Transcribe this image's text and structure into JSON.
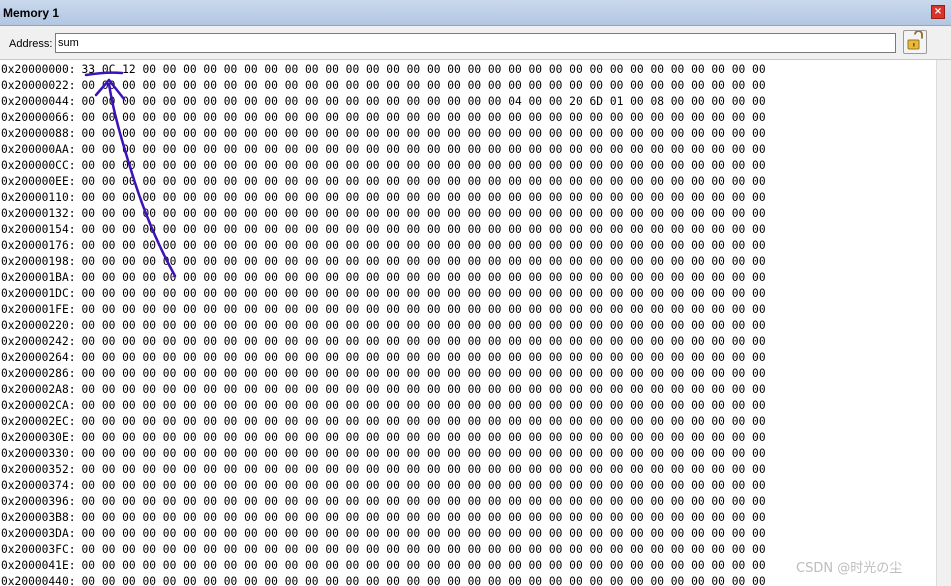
{
  "window": {
    "title": "Memory 1",
    "close_glyph": "×"
  },
  "toolbar": {
    "address_label": "Address:",
    "address_value": "sum",
    "lock_icon": "unlock-icon"
  },
  "memory": {
    "rows": [
      {
        "address": "0x20000000:",
        "bytes": "33 0C 12 00 00 00 00 00 00 00 00 00 00 00 00 00 00 00 00 00 00 00 00 00 00 00 00 00 00 00 00 00 00 00"
      },
      {
        "address": "0x20000022:",
        "bytes": "00 00 00 00 00 00 00 00 00 00 00 00 00 00 00 00 00 00 00 00 00 00 00 00 00 00 00 00 00 00 00 00 00 00"
      },
      {
        "address": "0x20000044:",
        "bytes": "00 00 00 00 00 00 00 00 00 00 00 00 00 00 00 00 00 00 00 00 00 04 00 00 20 6D 01 00 08 00 00 00 00 00"
      },
      {
        "address": "0x20000066:",
        "bytes": "00 00 00 00 00 00 00 00 00 00 00 00 00 00 00 00 00 00 00 00 00 00 00 00 00 00 00 00 00 00 00 00 00 00"
      },
      {
        "address": "0x20000088:",
        "bytes": "00 00 00 00 00 00 00 00 00 00 00 00 00 00 00 00 00 00 00 00 00 00 00 00 00 00 00 00 00 00 00 00 00 00"
      },
      {
        "address": "0x200000AA:",
        "bytes": "00 00 00 00 00 00 00 00 00 00 00 00 00 00 00 00 00 00 00 00 00 00 00 00 00 00 00 00 00 00 00 00 00 00"
      },
      {
        "address": "0x200000CC:",
        "bytes": "00 00 00 00 00 00 00 00 00 00 00 00 00 00 00 00 00 00 00 00 00 00 00 00 00 00 00 00 00 00 00 00 00 00"
      },
      {
        "address": "0x200000EE:",
        "bytes": "00 00 00 00 00 00 00 00 00 00 00 00 00 00 00 00 00 00 00 00 00 00 00 00 00 00 00 00 00 00 00 00 00 00"
      },
      {
        "address": "0x20000110:",
        "bytes": "00 00 00 00 00 00 00 00 00 00 00 00 00 00 00 00 00 00 00 00 00 00 00 00 00 00 00 00 00 00 00 00 00 00"
      },
      {
        "address": "0x20000132:",
        "bytes": "00 00 00 00 00 00 00 00 00 00 00 00 00 00 00 00 00 00 00 00 00 00 00 00 00 00 00 00 00 00 00 00 00 00"
      },
      {
        "address": "0x20000154:",
        "bytes": "00 00 00 00 00 00 00 00 00 00 00 00 00 00 00 00 00 00 00 00 00 00 00 00 00 00 00 00 00 00 00 00 00 00"
      },
      {
        "address": "0x20000176:",
        "bytes": "00 00 00 00 00 00 00 00 00 00 00 00 00 00 00 00 00 00 00 00 00 00 00 00 00 00 00 00 00 00 00 00 00 00"
      },
      {
        "address": "0x20000198:",
        "bytes": "00 00 00 00 00 00 00 00 00 00 00 00 00 00 00 00 00 00 00 00 00 00 00 00 00 00 00 00 00 00 00 00 00 00"
      },
      {
        "address": "0x200001BA:",
        "bytes": "00 00 00 00 00 00 00 00 00 00 00 00 00 00 00 00 00 00 00 00 00 00 00 00 00 00 00 00 00 00 00 00 00 00"
      },
      {
        "address": "0x200001DC:",
        "bytes": "00 00 00 00 00 00 00 00 00 00 00 00 00 00 00 00 00 00 00 00 00 00 00 00 00 00 00 00 00 00 00 00 00 00"
      },
      {
        "address": "0x200001FE:",
        "bytes": "00 00 00 00 00 00 00 00 00 00 00 00 00 00 00 00 00 00 00 00 00 00 00 00 00 00 00 00 00 00 00 00 00 00"
      },
      {
        "address": "0x20000220:",
        "bytes": "00 00 00 00 00 00 00 00 00 00 00 00 00 00 00 00 00 00 00 00 00 00 00 00 00 00 00 00 00 00 00 00 00 00"
      },
      {
        "address": "0x20000242:",
        "bytes": "00 00 00 00 00 00 00 00 00 00 00 00 00 00 00 00 00 00 00 00 00 00 00 00 00 00 00 00 00 00 00 00 00 00"
      },
      {
        "address": "0x20000264:",
        "bytes": "00 00 00 00 00 00 00 00 00 00 00 00 00 00 00 00 00 00 00 00 00 00 00 00 00 00 00 00 00 00 00 00 00 00"
      },
      {
        "address": "0x20000286:",
        "bytes": "00 00 00 00 00 00 00 00 00 00 00 00 00 00 00 00 00 00 00 00 00 00 00 00 00 00 00 00 00 00 00 00 00 00"
      },
      {
        "address": "0x200002A8:",
        "bytes": "00 00 00 00 00 00 00 00 00 00 00 00 00 00 00 00 00 00 00 00 00 00 00 00 00 00 00 00 00 00 00 00 00 00"
      },
      {
        "address": "0x200002CA:",
        "bytes": "00 00 00 00 00 00 00 00 00 00 00 00 00 00 00 00 00 00 00 00 00 00 00 00 00 00 00 00 00 00 00 00 00 00"
      },
      {
        "address": "0x200002EC:",
        "bytes": "00 00 00 00 00 00 00 00 00 00 00 00 00 00 00 00 00 00 00 00 00 00 00 00 00 00 00 00 00 00 00 00 00 00"
      },
      {
        "address": "0x2000030E:",
        "bytes": "00 00 00 00 00 00 00 00 00 00 00 00 00 00 00 00 00 00 00 00 00 00 00 00 00 00 00 00 00 00 00 00 00 00"
      },
      {
        "address": "0x20000330:",
        "bytes": "00 00 00 00 00 00 00 00 00 00 00 00 00 00 00 00 00 00 00 00 00 00 00 00 00 00 00 00 00 00 00 00 00 00"
      },
      {
        "address": "0x20000352:",
        "bytes": "00 00 00 00 00 00 00 00 00 00 00 00 00 00 00 00 00 00 00 00 00 00 00 00 00 00 00 00 00 00 00 00 00 00"
      },
      {
        "address": "0x20000374:",
        "bytes": "00 00 00 00 00 00 00 00 00 00 00 00 00 00 00 00 00 00 00 00 00 00 00 00 00 00 00 00 00 00 00 00 00 00"
      },
      {
        "address": "0x20000396:",
        "bytes": "00 00 00 00 00 00 00 00 00 00 00 00 00 00 00 00 00 00 00 00 00 00 00 00 00 00 00 00 00 00 00 00 00 00"
      },
      {
        "address": "0x200003B8:",
        "bytes": "00 00 00 00 00 00 00 00 00 00 00 00 00 00 00 00 00 00 00 00 00 00 00 00 00 00 00 00 00 00 00 00 00 00"
      },
      {
        "address": "0x200003DA:",
        "bytes": "00 00 00 00 00 00 00 00 00 00 00 00 00 00 00 00 00 00 00 00 00 00 00 00 00 00 00 00 00 00 00 00 00 00"
      },
      {
        "address": "0x200003FC:",
        "bytes": "00 00 00 00 00 00 00 00 00 00 00 00 00 00 00 00 00 00 00 00 00 00 00 00 00 00 00 00 00 00 00 00 00 00"
      },
      {
        "address": "0x2000041E:",
        "bytes": "00 00 00 00 00 00 00 00 00 00 00 00 00 00 00 00 00 00 00 00 00 00 00 00 00 00 00 00 00 00 00 00 00 00"
      },
      {
        "address": "0x20000440:",
        "bytes": "00 00 00 00 00 00 00 00 00 00 00 00 00 00 00 00 00 00 00 00 00 00 00 00 00 00 00 00 00 00 00 00 00 00"
      }
    ]
  },
  "annotation": {
    "color": "#3d12b8"
  },
  "watermark": {
    "text": "CSDN @时光の尘"
  }
}
